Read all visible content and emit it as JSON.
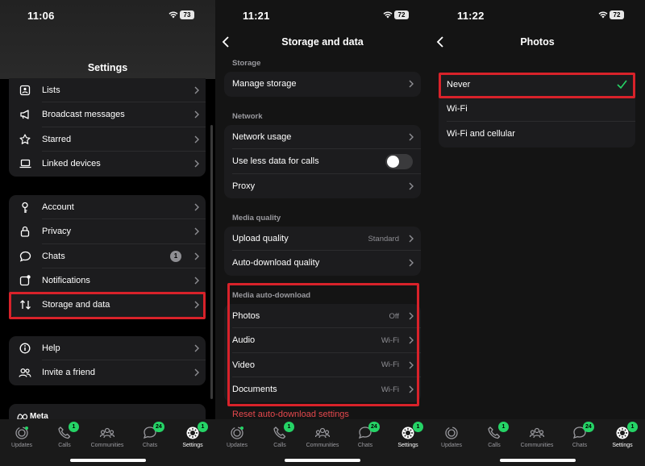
{
  "panels": [
    {
      "time": "11:06",
      "battery": "73",
      "title": "Settings"
    },
    {
      "time": "11:21",
      "battery": "72",
      "title": "Storage and data"
    },
    {
      "time": "11:22",
      "battery": "72",
      "title": "Photos"
    }
  ],
  "settings": {
    "group1": [
      "Lists",
      "Broadcast messages",
      "Starred",
      "Linked devices"
    ],
    "group2": [
      "Account",
      "Privacy",
      "Chats",
      "Notifications",
      "Storage and data"
    ],
    "chats_badge": "1",
    "group3": [
      "Help",
      "Invite a friend"
    ],
    "meta_label": "Meta"
  },
  "storage": {
    "sections": [
      "Storage",
      "Network",
      "Media quality",
      "Media auto-download"
    ],
    "storage_items": [
      "Manage storage"
    ],
    "network_items": [
      "Network usage",
      "Use less data for calls",
      "Proxy"
    ],
    "media_quality": [
      {
        "label": "Upload quality",
        "value": "Standard"
      },
      {
        "label": "Auto-download quality",
        "value": ""
      }
    ],
    "auto_download": [
      {
        "label": "Photos",
        "value": "Off"
      },
      {
        "label": "Audio",
        "value": "Wi-Fi"
      },
      {
        "label": "Video",
        "value": "Wi-Fi"
      },
      {
        "label": "Documents",
        "value": "Wi-Fi"
      }
    ],
    "reset_label": "Reset auto-download settings"
  },
  "photos": {
    "options": [
      "Never",
      "Wi-Fi",
      "Wi-Fi and cellular"
    ],
    "selected": "Never"
  },
  "tabbar": {
    "labels": [
      "Updates",
      "Calls",
      "Communities",
      "Chats",
      "Settings"
    ],
    "calls_badge": "1",
    "chats_badge": "24",
    "settings_badge": "1"
  },
  "colors": {
    "accent": "#25d366",
    "highlight": "#d8222a",
    "reset": "#e5484d"
  }
}
